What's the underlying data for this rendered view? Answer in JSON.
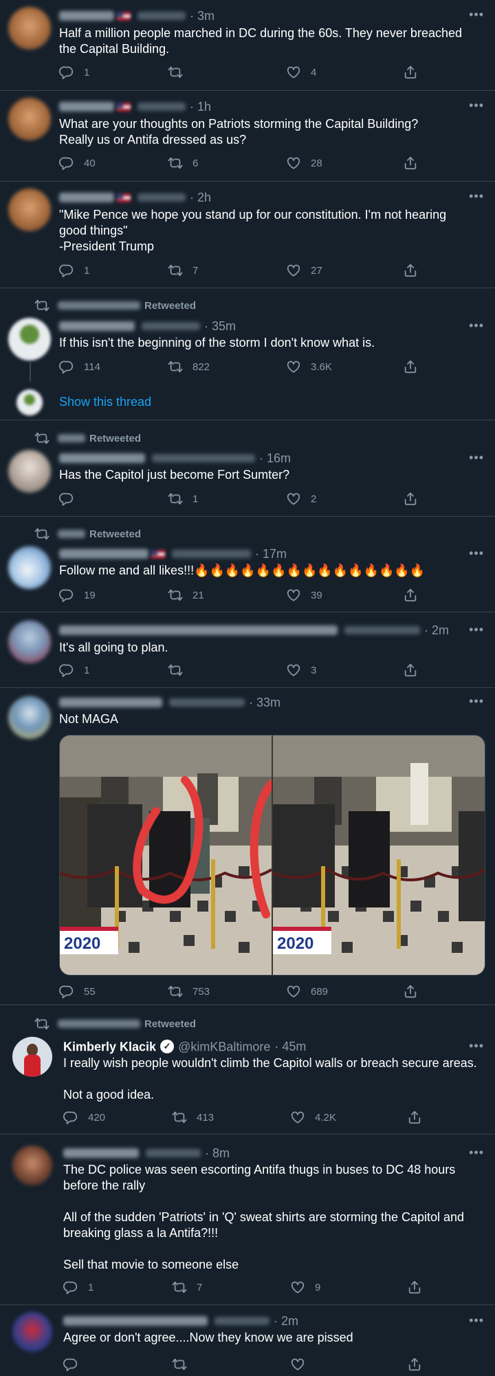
{
  "icons": {
    "reply": "reply-icon",
    "retweet": "retweet-icon",
    "like": "heart-icon",
    "share": "share-icon",
    "more": "more-icon",
    "verified": "verified-badge-icon"
  },
  "colors": {
    "background": "#15202b",
    "divider": "#38444d",
    "muted": "#8899a6",
    "link": "#1da1f2",
    "text": "#ffffff"
  },
  "tweets": [
    {
      "time": "· 3m",
      "text": "Half a million people marched in DC during the 60s. They never breached the Capital Building.",
      "replies": "1",
      "retweets": "",
      "likes": "4"
    },
    {
      "time": "· 1h",
      "text": "What are your thoughts on Patriots storming the Capital Building?\nReally us or Antifa dressed as us?",
      "replies": "40",
      "retweets": "6",
      "likes": "28"
    },
    {
      "time": "· 2h",
      "text": "\"Mike Pence we hope you stand up for our constitution. I'm not hearing good things\"\n-President Trump",
      "replies": "1",
      "retweets": "7",
      "likes": "27"
    },
    {
      "retweeted_label": "Retweeted",
      "time": "· 35m",
      "text": "If this isn't the beginning of the storm I don't know what is.",
      "replies": "114",
      "retweets": "822",
      "likes": "3.6K",
      "show_thread": "Show this thread"
    },
    {
      "retweeted_label": "Retweeted",
      "time": "· 16m",
      "text": "Has the Capitol just become Fort Sumter?",
      "replies": "",
      "retweets": "1",
      "likes": "2"
    },
    {
      "retweeted_label": "Retweeted",
      "time": "· 17m",
      "text": "Follow me and all likes!!!🔥🔥🔥🔥🔥🔥🔥🔥🔥🔥🔥🔥🔥🔥🔥",
      "replies": "19",
      "retweets": "21",
      "likes": "39"
    },
    {
      "time": "· 2m",
      "text": "It's all going to plan.",
      "replies": "1",
      "retweets": "",
      "likes": "3"
    },
    {
      "time": "· 33m",
      "text": "Not MAGA",
      "media_label": "2020",
      "replies": "55",
      "retweets": "753",
      "likes": "689"
    },
    {
      "retweeted_label": "Retweeted",
      "name": "Kimberly Klacik",
      "handle": "@kimKBaltimore",
      "time": "· 45m",
      "text": "I really wish people wouldn't climb the Capitol walls or breach secure areas.\n\nNot a good idea.",
      "replies": "420",
      "retweets": "413",
      "likes": "4.2K"
    },
    {
      "time": "· 8m",
      "text": "The DC police was seen escorting Antifa thugs in buses to DC 48 hours before the rally\n\nAll of the sudden 'Patriots' in 'Q' sweat shirts are storming the Capitol and breaking glass a la Antifa?!!!\n\nSell that movie to someone else",
      "replies": "1",
      "retweets": "7",
      "likes": "9"
    },
    {
      "time": "· 2m",
      "text": "Agree or don't agree....Now they know we are pissed",
      "replies": "",
      "retweets": "",
      "likes": ""
    }
  ]
}
